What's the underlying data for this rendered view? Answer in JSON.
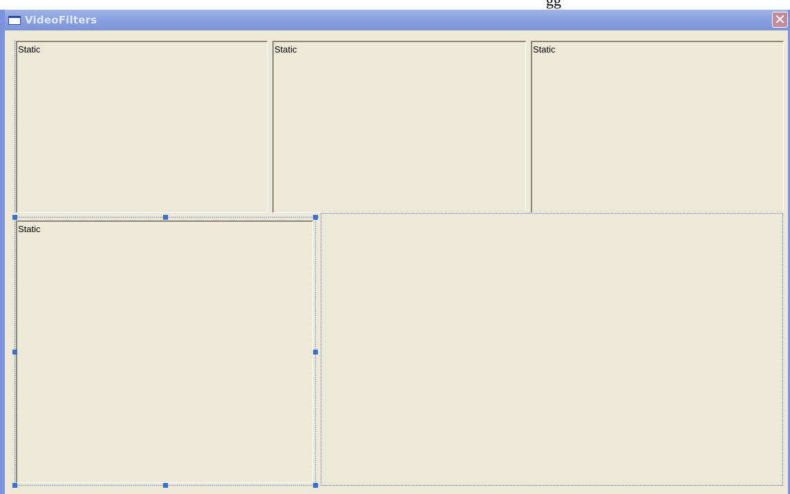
{
  "cropped_top_text": "gg",
  "window": {
    "title": "VideoFilters",
    "close_label": "✕"
  },
  "panels": [
    {
      "label": "Static"
    },
    {
      "label": "Static"
    },
    {
      "label": "Static"
    },
    {
      "label": "Static"
    }
  ],
  "colors": {
    "title_bar": "#8aa2df",
    "face": "#ece9d8",
    "handle": "#3a6fcf",
    "close_button": "#c08b9c"
  }
}
